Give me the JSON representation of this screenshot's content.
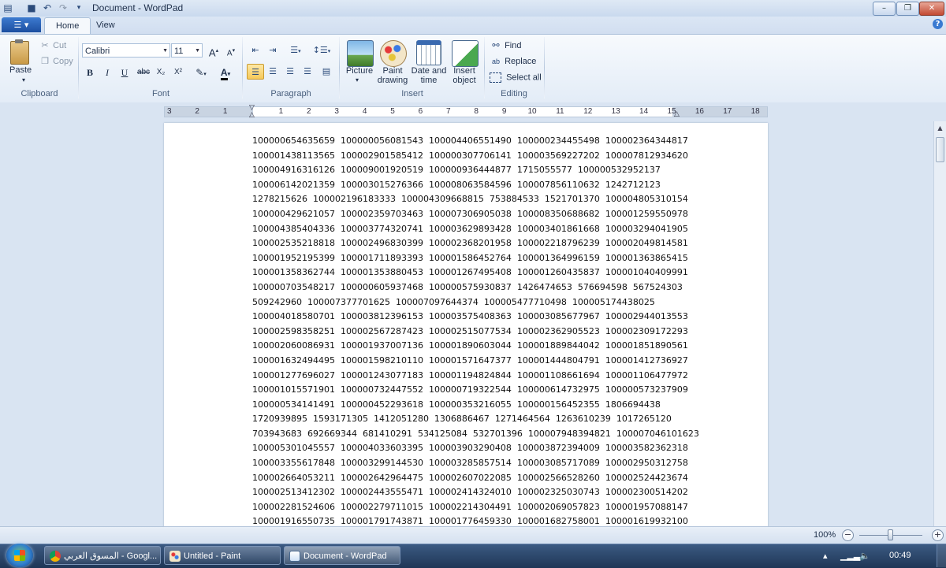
{
  "window": {
    "title": "Document - WordPad",
    "controls": {
      "minimize": "–",
      "maximize": "❐",
      "close": "✕"
    }
  },
  "app_menu": {
    "label": "☰ ▾"
  },
  "tabs": [
    {
      "label": "Home",
      "active": true
    },
    {
      "label": "View",
      "active": false
    }
  ],
  "help": {
    "label": "?"
  },
  "ribbon": {
    "clipboard": {
      "label": "Clipboard",
      "paste": "Paste",
      "cut": "Cut",
      "copy": "Copy"
    },
    "font": {
      "label": "Font",
      "family": "Calibri",
      "size": "11",
      "grow": "A",
      "shrink": "A",
      "bold": "B",
      "italic": "I",
      "underline": "U",
      "strike": "abc",
      "subscript": "X₂",
      "superscript": "X²",
      "color_letter": "A"
    },
    "paragraph": {
      "label": "Paragraph"
    },
    "insert": {
      "label": "Insert",
      "picture": "Picture",
      "paint_line1": "Paint",
      "paint_line2": "drawing",
      "datetime_line1": "Date and",
      "datetime_line2": "time",
      "object_line1": "Insert",
      "object_line2": "object"
    },
    "editing": {
      "label": "Editing",
      "find": "Find",
      "replace": "Replace",
      "select_all": "Select all"
    }
  },
  "ruler": {
    "ticks": [
      "3",
      "2",
      "1",
      "1",
      "2",
      "3",
      "4",
      "5",
      "6",
      "7",
      "8",
      "9",
      "10",
      "11",
      "12",
      "13",
      "14",
      "15",
      "16",
      "17",
      "18"
    ]
  },
  "document": {
    "lines": [
      "100000654635659  100000056081543  100004406551490  100000234455498  100002364344817",
      "100001438113565  100002901585412  100000307706141  100003569227202  100007812934620",
      "100004916316126  100009001920519  100000936444877  1715055577  100000532952137",
      "100006142021359  100003015276366  100008063584596  100007856110632  1242712123",
      "1278215626  100002196183333  100004309668815  753884533  1521701370  100004805310154",
      "100000429621057  100002359703463  100007306905038  100008350688682  100001259550978",
      "100004385404336  100003774320741  100003629893428  100003401861668  100003294041905",
      "100002535218818  100002496830399  100002368201958  100002218796239  100002049814581",
      "100001952195399  100001711893393  100001586452764  100001364996159  100001363865415",
      "100001358362744  100001353880453  100001267495408  100001260435837  100001040409991",
      "100000703548217  100000605937468  100000575930837  1426474653  576694598  567524303",
      "509242960  100007377701625  100007097644374  100005477710498  100005174438025",
      "100004018580701  100003812396153  100003575408363  100003085677967  100002944013553",
      "100002598358251  100002567287423  100002515077534  100002362905523  100002309172293",
      "100002060086931  100001937007136  100001890603044  100001889844042  100001851890561",
      "100001632494495  100001598210110  100001571647377  100001444804791  100001412736927",
      "100001277696027  100001243077183  100001194824844  100001108661694  100001106477972",
      "100001015571901  100000732447552  100000719322544  100000614732975  100000573237909",
      "100000534141491  100000452293618  100000353216055  100000156452355  1806694438",
      "1720939895  1593171305  1412051280  1306886467  1271464564  1263610239  1017265120",
      "703943683  692669344  681410291  534125084  532701396  100007948394821  100007046101623",
      "100005301045557  100004033603395  100003903290408  100003872394009  100003582362318",
      "100003355617848  100003299144530  100003285857514  100003085717089  100002950312758",
      "100002664053211  100002642964475  100002607022085  100002566528260  100002524423674",
      "100002513412302  100002443555471  100002414324010  100002325030743  100002300514202",
      "100002281524606  100002279711015  100002214304491  100002069057823  100001957088147",
      "100001916550735  100001791743871  100001776459330  100001682758001  100001619932100"
    ]
  },
  "statusbar": {
    "zoom": "100%",
    "zoom_out": "−",
    "zoom_in": "+",
    "zoom_fraction": 0.5
  },
  "taskbar": {
    "items": [
      {
        "label": "المسوق العربي - Googl...",
        "active": false
      },
      {
        "label": "Untitled - Paint",
        "active": false
      },
      {
        "label": "Document - WordPad",
        "active": true
      }
    ],
    "clock": "00:49"
  },
  "colors": {
    "accent": "#1c4ea0",
    "ribbon": "#e3ecf7",
    "taskbar": "#1f3656"
  }
}
